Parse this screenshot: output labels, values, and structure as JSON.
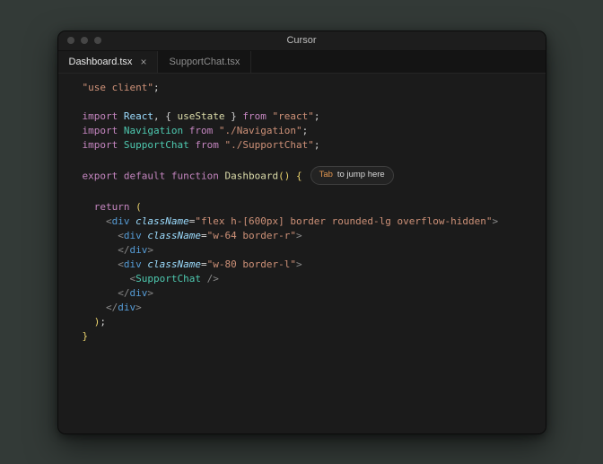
{
  "window": {
    "title": "Cursor",
    "tabs": [
      {
        "label": "Dashboard.tsx",
        "close_icon": "×",
        "active": true
      },
      {
        "label": "SupportChat.tsx",
        "active": false
      }
    ]
  },
  "colors": {
    "desktop_background": "#333a37",
    "editor_background": "#1b1b1b",
    "keyword": "#c586c0",
    "string": "#ce9178",
    "function": "#dcdcaa",
    "component": "#4ec9b0",
    "tag": "#569cd6",
    "attribute": "#9cdcfe",
    "hint_key": "#e0954f"
  },
  "code": {
    "lines": [
      [
        {
          "t": "str",
          "v": "\"use client\""
        },
        {
          "t": "txt",
          "v": ";"
        }
      ],
      [],
      [
        {
          "t": "kw",
          "v": "import"
        },
        {
          "t": "txt",
          "v": " "
        },
        {
          "t": "var",
          "v": "React"
        },
        {
          "t": "txt",
          "v": ", { "
        },
        {
          "t": "fn",
          "v": "useState"
        },
        {
          "t": "txt",
          "v": " } "
        },
        {
          "t": "kw",
          "v": "from"
        },
        {
          "t": "txt",
          "v": " "
        },
        {
          "t": "str",
          "v": "\"react\""
        },
        {
          "t": "txt",
          "v": ";"
        }
      ],
      [
        {
          "t": "kw",
          "v": "import"
        },
        {
          "t": "txt",
          "v": " "
        },
        {
          "t": "cls",
          "v": "Navigation"
        },
        {
          "t": "txt",
          "v": " "
        },
        {
          "t": "kw",
          "v": "from"
        },
        {
          "t": "txt",
          "v": " "
        },
        {
          "t": "str",
          "v": "\"./Navigation\""
        },
        {
          "t": "txt",
          "v": ";"
        }
      ],
      [
        {
          "t": "kw",
          "v": "import"
        },
        {
          "t": "txt",
          "v": " "
        },
        {
          "t": "cls",
          "v": "SupportChat"
        },
        {
          "t": "txt",
          "v": " "
        },
        {
          "t": "kw",
          "v": "from"
        },
        {
          "t": "txt",
          "v": " "
        },
        {
          "t": "str",
          "v": "\"./SupportChat\""
        },
        {
          "t": "txt",
          "v": ";"
        }
      ],
      [],
      [
        {
          "t": "kw",
          "v": "export"
        },
        {
          "t": "txt",
          "v": " "
        },
        {
          "t": "kw",
          "v": "default"
        },
        {
          "t": "txt",
          "v": " "
        },
        {
          "t": "kw",
          "v": "function"
        },
        {
          "t": "txt",
          "v": " "
        },
        {
          "t": "fn",
          "v": "Dashboard"
        },
        {
          "t": "brk",
          "v": "()"
        },
        {
          "t": "txt",
          "v": " "
        },
        {
          "t": "brk",
          "v": "{"
        },
        {
          "t": "hint",
          "k": "Tab",
          "v": "to jump here"
        }
      ],
      [],
      [
        {
          "t": "txt",
          "v": "  "
        },
        {
          "t": "kw",
          "v": "return"
        },
        {
          "t": "txt",
          "v": " "
        },
        {
          "t": "brk",
          "v": "("
        }
      ],
      [
        {
          "t": "txt",
          "v": "    "
        },
        {
          "t": "ang",
          "v": "<"
        },
        {
          "t": "tag",
          "v": "div"
        },
        {
          "t": "txt",
          "v": " "
        },
        {
          "t": "attr",
          "v": "className"
        },
        {
          "t": "txt",
          "v": "="
        },
        {
          "t": "str",
          "v": "\"flex h-[600px] border rounded-lg overflow-hidden\""
        },
        {
          "t": "ang",
          "v": ">"
        }
      ],
      [
        {
          "t": "txt",
          "v": "      "
        },
        {
          "t": "ang",
          "v": "<"
        },
        {
          "t": "tag",
          "v": "div"
        },
        {
          "t": "txt",
          "v": " "
        },
        {
          "t": "attr",
          "v": "className"
        },
        {
          "t": "txt",
          "v": "="
        },
        {
          "t": "str",
          "v": "\"w-64 border-r\""
        },
        {
          "t": "ang",
          "v": ">"
        }
      ],
      [
        {
          "t": "txt",
          "v": "      "
        },
        {
          "t": "ang",
          "v": "</"
        },
        {
          "t": "tag",
          "v": "div"
        },
        {
          "t": "ang",
          "v": ">"
        }
      ],
      [
        {
          "t": "txt",
          "v": "      "
        },
        {
          "t": "ang",
          "v": "<"
        },
        {
          "t": "tag",
          "v": "div"
        },
        {
          "t": "txt",
          "v": " "
        },
        {
          "t": "attr",
          "v": "className"
        },
        {
          "t": "txt",
          "v": "="
        },
        {
          "t": "str",
          "v": "\"w-80 border-l\""
        },
        {
          "t": "ang",
          "v": ">"
        }
      ],
      [
        {
          "t": "txt",
          "v": "        "
        },
        {
          "t": "ang",
          "v": "<"
        },
        {
          "t": "cls",
          "v": "SupportChat"
        },
        {
          "t": "txt",
          "v": " "
        },
        {
          "t": "ang",
          "v": "/>"
        }
      ],
      [
        {
          "t": "txt",
          "v": "      "
        },
        {
          "t": "ang",
          "v": "</"
        },
        {
          "t": "tag",
          "v": "div"
        },
        {
          "t": "ang",
          "v": ">"
        }
      ],
      [
        {
          "t": "txt",
          "v": "    "
        },
        {
          "t": "ang",
          "v": "</"
        },
        {
          "t": "tag",
          "v": "div"
        },
        {
          "t": "ang",
          "v": ">"
        }
      ],
      [
        {
          "t": "txt",
          "v": "  "
        },
        {
          "t": "brk",
          "v": ")"
        },
        {
          "t": "txt",
          "v": ";"
        }
      ],
      [
        {
          "t": "brk",
          "v": "}"
        }
      ]
    ]
  }
}
